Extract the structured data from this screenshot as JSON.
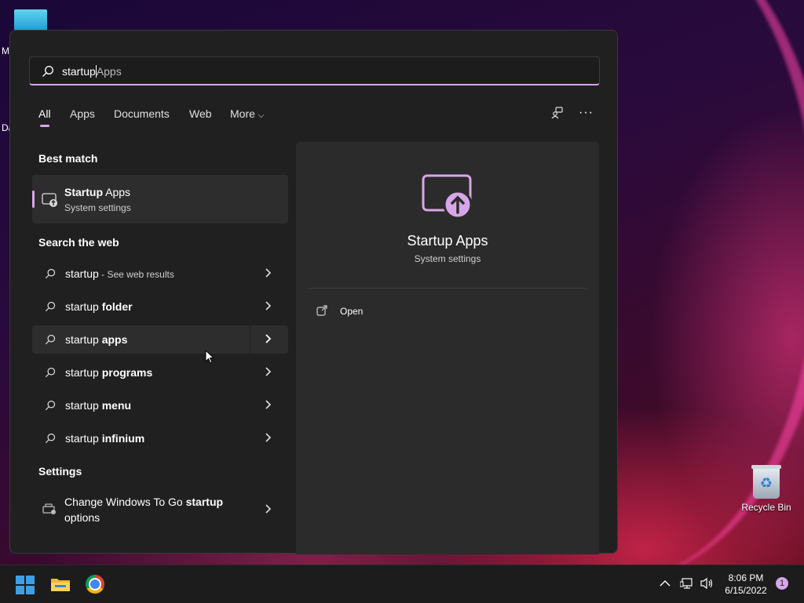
{
  "desktop": {
    "side_letters": [
      "M",
      "Da"
    ],
    "recycle_bin_label": "Recycle Bin"
  },
  "search": {
    "typed": "startup",
    "suggestion_suffix": "Apps"
  },
  "tabs": [
    {
      "label": "All",
      "active": true
    },
    {
      "label": "Apps",
      "active": false
    },
    {
      "label": "Documents",
      "active": false
    },
    {
      "label": "Web",
      "active": false
    },
    {
      "label": "More",
      "active": false
    }
  ],
  "sections": {
    "best_match": "Best match",
    "search_web": "Search the web",
    "settings": "Settings"
  },
  "best_match": {
    "title_bold": "Startup",
    "title_rest": " Apps",
    "subtitle": "System settings",
    "icon": "startup-apps-icon"
  },
  "web_results": [
    {
      "prefix": "startup",
      "bold": "",
      "small": " - See web results"
    },
    {
      "prefix": "startup ",
      "bold": "folder",
      "small": ""
    },
    {
      "prefix": "startup ",
      "bold": "apps",
      "small": ""
    },
    {
      "prefix": "startup ",
      "bold": "programs",
      "small": ""
    },
    {
      "prefix": "startup ",
      "bold": "menu",
      "small": ""
    },
    {
      "prefix": "startup ",
      "bold": "infinium",
      "small": ""
    }
  ],
  "settings_result": {
    "text_before": "Change Windows To Go ",
    "text_bold": "startup",
    "text_after": " options",
    "icon": "settings-drive-icon"
  },
  "detail": {
    "title": "Startup Apps",
    "subtitle": "System settings",
    "open_label": "Open"
  },
  "taskbar": {
    "time": "8:06 PM",
    "date": "6/15/2022",
    "notification_count": "1"
  },
  "colors": {
    "accent": "#d7a6e8",
    "panel_bg": "#202020",
    "detail_bg": "#2b2b2b",
    "taskbar_bg": "#1c1c1c"
  }
}
